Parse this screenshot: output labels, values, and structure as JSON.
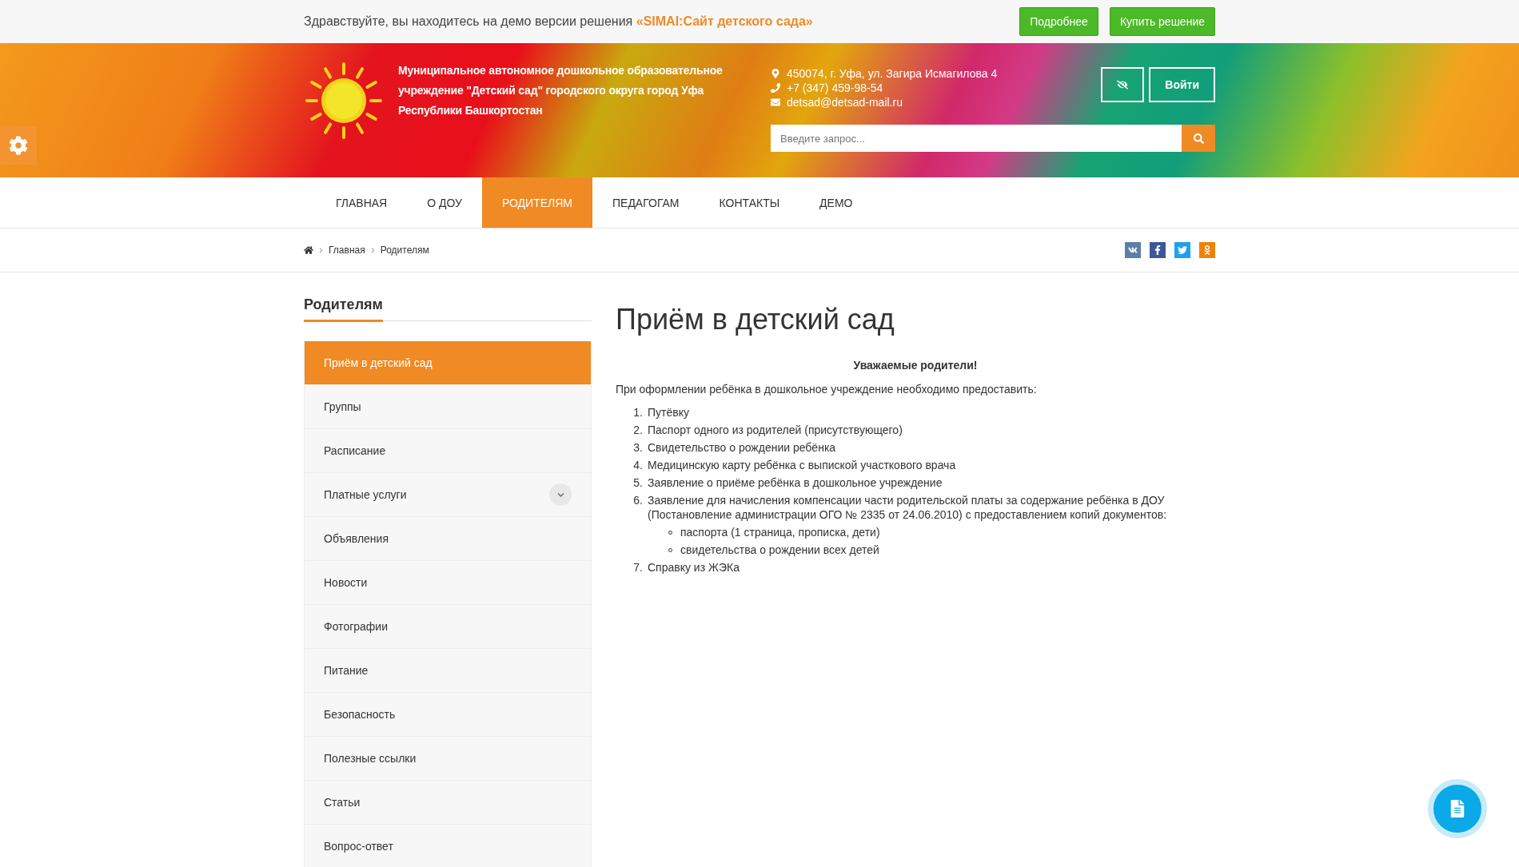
{
  "demo_bar": {
    "text": "Здравствуйте, вы находитесь на демо версии решения",
    "highlight": "«SIMAI:Сайт детского сада»",
    "buttons": [
      "Подробнее",
      "Купить решение"
    ]
  },
  "header": {
    "org_name": "Муниципальное автономное дошкольное образовательное учреждение \"Детский сад\" городского округа город Уфа Республики Башкортостан",
    "contacts": [
      {
        "kind": "address",
        "text": "450074, г. Уфа, ул. Загира Исмагилова 4"
      },
      {
        "kind": "phone",
        "text": "+7 (347) 459-98-54"
      },
      {
        "kind": "email",
        "text": "detsad@detsad-mail.ru"
      }
    ],
    "login_button": "Войти",
    "search": {
      "placeholder": "Введите запрос..."
    }
  },
  "nav": [
    {
      "label": "ГЛАВНАЯ",
      "selected": false
    },
    {
      "label": "О ДОУ",
      "selected": false
    },
    {
      "label": "РОДИТЕЛЯМ",
      "selected": true
    },
    {
      "label": "ПЕДАГОГАМ",
      "selected": false
    },
    {
      "label": "КОНТАКТЫ",
      "selected": false
    },
    {
      "label": "ДЕМО",
      "selected": false
    }
  ],
  "breadcrumbs": [
    "Главная",
    "Родителям"
  ],
  "social": [
    {
      "kind": "vk",
      "color": "#5b7fa6"
    },
    {
      "kind": "facebook",
      "color": "#3b5998"
    },
    {
      "kind": "twitter",
      "color": "#1da1f2"
    },
    {
      "kind": "ok",
      "color": "#ee8208"
    }
  ],
  "sidebar": {
    "title": "Родителям",
    "items": [
      {
        "label": "Приём в детский сад",
        "selected": true,
        "expandable": false
      },
      {
        "label": "Группы",
        "selected": false,
        "expandable": false
      },
      {
        "label": "Расписание",
        "selected": false,
        "expandable": false
      },
      {
        "label": "Платные услуги",
        "selected": false,
        "expandable": true
      },
      {
        "label": "Объявления",
        "selected": false,
        "expandable": false
      },
      {
        "label": "Новости",
        "selected": false,
        "expandable": false
      },
      {
        "label": "Фотографии",
        "selected": false,
        "expandable": false
      },
      {
        "label": "Питание",
        "selected": false,
        "expandable": false
      },
      {
        "label": "Безопасность",
        "selected": false,
        "expandable": false
      },
      {
        "label": "Полезные ссылки",
        "selected": false,
        "expandable": false
      },
      {
        "label": "Статьи",
        "selected": false,
        "expandable": false
      },
      {
        "label": "Вопрос-ответ",
        "selected": false,
        "expandable": false
      }
    ]
  },
  "article": {
    "title": "Приём в детский сад",
    "greeting": "Уважаемые родители!",
    "intro": "При оформлении ребёнка в дошкольное учреждение необходимо предоставить:",
    "list": [
      {
        "number": "1.",
        "text": "Путёвку"
      },
      {
        "number": "2.",
        "text": "Паспорт одного из родителей (присутствующего)"
      },
      {
        "number": "3.",
        "text": "Свидетельство о рождении ребёнка"
      },
      {
        "number": "4.",
        "text": "Медицинскую карту ребёнка с выпиской участкового врача"
      },
      {
        "number": "5.",
        "text": "Заявление о приёме ребёнка в дошкольное учреждение"
      },
      {
        "number": "6.",
        "text": "Заявление для начисления компенсации части родительской платы за содержание ребёнка в ДОУ (Постановление администрации ОГО № 2335 от 24.06.2010) с предоставлением копий документов:",
        "children": [
          "паспорта (1 страница, прописка, дети)",
          "свидетельства о рождении всех детей"
        ]
      },
      {
        "number": "7.",
        "text": "Справку из ЖЭКа"
      }
    ]
  }
}
